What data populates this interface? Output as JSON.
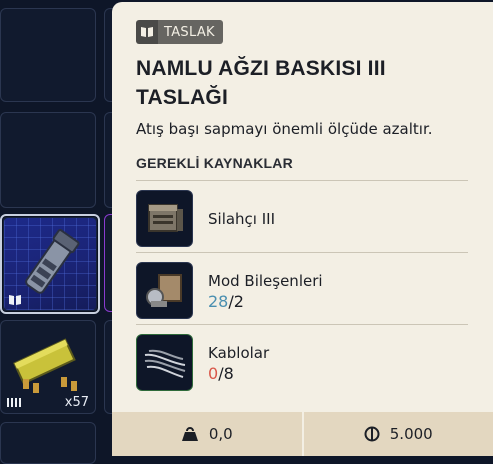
{
  "inventory": {
    "ammo_count": "x57"
  },
  "tooltip": {
    "tag_label": "TASLAK",
    "title": "NAMLU AĞZI BASKISI III TASLAĞI",
    "description": "Atış başı sapmayı önemli ölçüde azaltır.",
    "section_label": "GEREKLİ KAYNAKLAR",
    "requirements": [
      {
        "name": "Silahçı III",
        "icon": "workbench-icon"
      },
      {
        "name": "Mod Bileşenleri",
        "have": "28",
        "need": "/2",
        "status": "sufficient",
        "icon": "mod-components-icon"
      },
      {
        "name": "Kablolar",
        "have": "0",
        "need": "/8",
        "status": "insufficient",
        "icon": "wires-icon"
      }
    ],
    "footer": {
      "weight": "0,0",
      "value": "5.000"
    }
  },
  "colors": {
    "panel_bg": "#f3efe4",
    "footer_bg": "#e3d7c0",
    "sufficient": "#4a8fb0",
    "insufficient": "#d9574a"
  }
}
